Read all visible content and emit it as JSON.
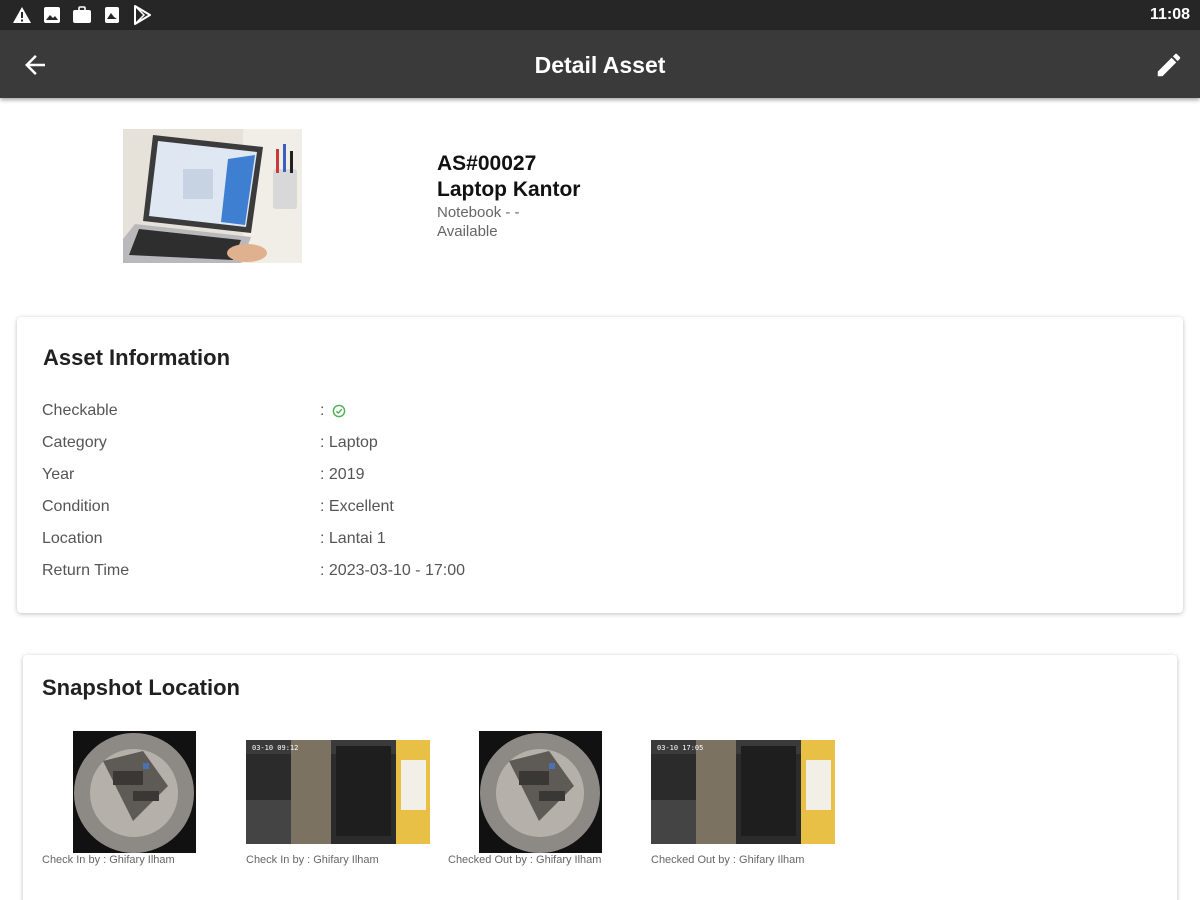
{
  "status_bar": {
    "time": "11:08",
    "icons": [
      "warning-icon",
      "image-icon",
      "briefcase-icon",
      "photo-icon",
      "play-store-icon"
    ]
  },
  "app_bar": {
    "title": "Detail Asset",
    "back_icon": "arrow-back-icon",
    "edit_icon": "edit-pencil-icon"
  },
  "asset": {
    "code": "AS#00027",
    "name": "Laptop Kantor",
    "type": "Notebook - -",
    "status": "Available",
    "photo": "laptop-photo"
  },
  "asset_info": {
    "title": "Asset Information",
    "rows": [
      {
        "label": "Checkable",
        "value": ": ",
        "icon": "check-circle-icon",
        "icon_color": "#4caf50"
      },
      {
        "label": "Category",
        "value": ": Laptop"
      },
      {
        "label": "Year",
        "value": ": 2019"
      },
      {
        "label": "Condition",
        "value": ": Excellent"
      },
      {
        "label": "Location",
        "value": ": Lantai 1"
      },
      {
        "label": "Return Time",
        "value": ": 2023-03-10 - 17:00"
      }
    ]
  },
  "snapshot_location": {
    "title": "Snapshot Location",
    "items": [
      {
        "caption": "Check In by : Ghifary Ilham",
        "image": "fisheye-cctv-snapshot"
      },
      {
        "caption": "Check In by : Ghifary Ilham",
        "image": "cctv-room-snapshot"
      },
      {
        "caption": "Checked Out by : Ghifary Ilham",
        "image": "fisheye-cctv-snapshot"
      },
      {
        "caption": "Checked Out by : Ghifary Ilham",
        "image": "cctv-room-snapshot"
      }
    ]
  },
  "colors": {
    "status_bar": "#262626",
    "app_bar": "#3a3a3a",
    "check_green": "#4caf50"
  }
}
